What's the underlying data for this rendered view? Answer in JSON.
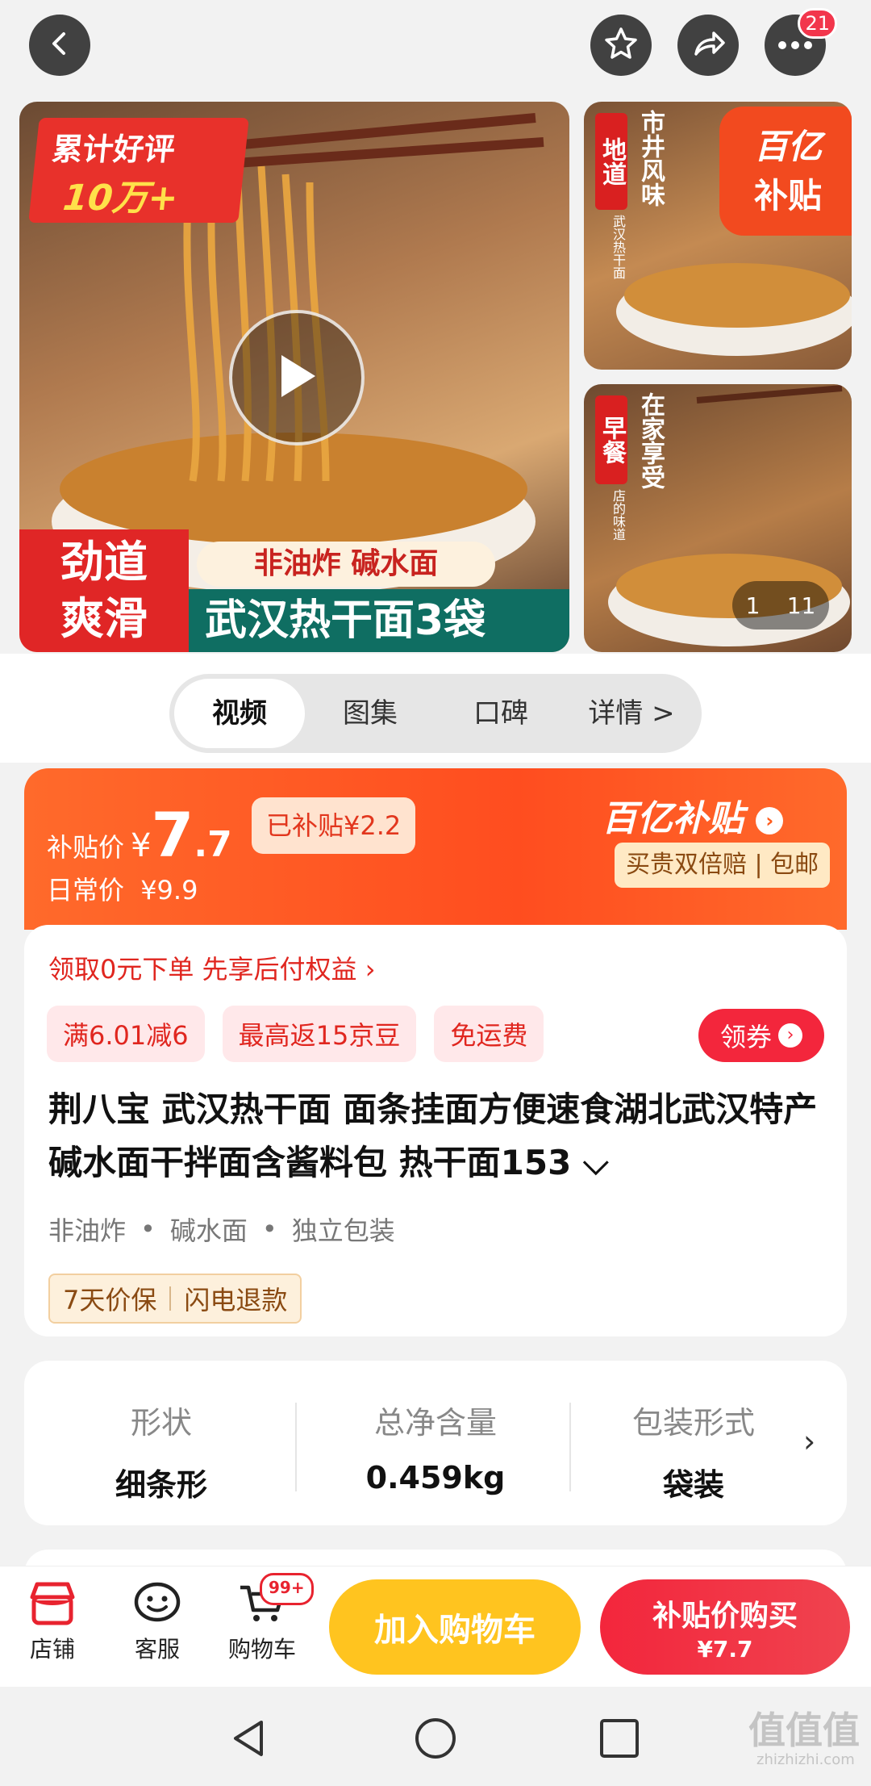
{
  "header": {
    "back_icon": "back-arrow-icon",
    "star_icon": "star-icon",
    "share_icon": "share-icon",
    "more_icon": "more-dots-icon",
    "more_badge": "21"
  },
  "gallery": {
    "main": {
      "badge_line1": "累计好评",
      "badge_line2": "10万+",
      "left_box_line1": "劲道",
      "left_box_line2": "爽滑",
      "sub_banner": "非油炸 碱水面",
      "main_banner": "武汉热干面3袋",
      "play_icon": "play-icon"
    },
    "thumb1": {
      "red_label": "地道",
      "vertical_text": "市井风味",
      "small_text": "武汉热干面",
      "corner_line1": "百亿",
      "corner_line2": "补贴"
    },
    "thumb2": {
      "red_label": "早餐",
      "vertical_text": "在家享受",
      "small_text": "店的味道",
      "counter_current": "1",
      "counter_total": "11"
    }
  },
  "tabs": [
    "视频",
    "图集",
    "口碑",
    "详情 >"
  ],
  "price": {
    "label": "补贴价",
    "currency": "¥",
    "int": "7",
    "dec": ".7",
    "subsidy_tag": "已补贴¥2.2",
    "daily_label": "日常价",
    "daily_price": "¥9.9",
    "brand": "百亿补贴",
    "brand_sub": "买贵双倍赔 | 包邮"
  },
  "promo": {
    "line": "领取0元下单 先享后付权益 ›",
    "tags": [
      "满6.01减6",
      "最高返15京豆",
      "免运费"
    ],
    "coupon_btn": "领券"
  },
  "product": {
    "title": "荆八宝 武汉热干面 面条挂面方便速食湖北武汉特产碱水面干拌面含酱料包 热干面153 ⌵",
    "features": [
      "非油炸",
      "碱水面",
      "独立包装"
    ],
    "services": [
      "7天价保",
      "闪电退款"
    ]
  },
  "specs": [
    {
      "label": "形状",
      "value": "细条形"
    },
    {
      "label": "总净含量",
      "value": "0.459kg"
    },
    {
      "label": "包装形式",
      "value": "袋装"
    }
  ],
  "bottom_bar": {
    "shop": "店铺",
    "service": "客服",
    "cart": "购物车",
    "cart_badge": "99+",
    "add_cart": "加入购物车",
    "buy_line1": "补贴价购买",
    "buy_line2": "¥7.7"
  },
  "watermark": {
    "big": "值值值",
    "small": "zhizhizhi.com"
  },
  "colors": {
    "accent_red": "#e8232f",
    "accent_orange": "#ff5b1a",
    "cart_yellow": "#ffc41f",
    "buy_red": "#f3263c"
  }
}
